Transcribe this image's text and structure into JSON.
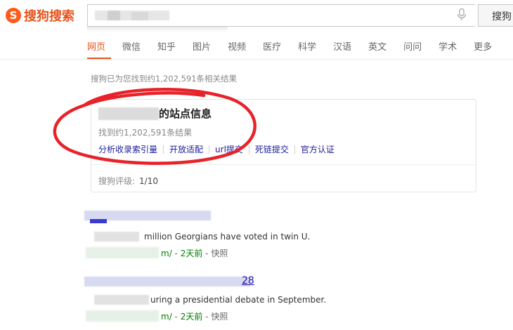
{
  "header": {
    "logo_text": "搜狗搜索",
    "logo_mark": "S",
    "search_button": "搜狗",
    "search_value": "",
    "mic_icon": "microphone-icon"
  },
  "tabs": [
    "网页",
    "微信",
    "知乎",
    "图片",
    "视频",
    "医疗",
    "科学",
    "汉语",
    "英文",
    "问问",
    "学术",
    "更多"
  ],
  "active_tab": "网页",
  "result_count_text": "搜狗已为您找到约1,202,591条相关结果",
  "site_card": {
    "title_suffix": "的站点信息",
    "count_text": "找到约1,202,591条结果",
    "links": [
      "分析收录索引量",
      "开放适配",
      "url提交",
      "死链提交",
      "官方认证"
    ],
    "rating_label": "搜狗评级:",
    "rating_value": "1/10"
  },
  "results": [
    {
      "title_tail": "",
      "snippet": "million Georgians have voted in twin U.",
      "url_tail": "m/",
      "time": "2天前",
      "snapshot": "快照"
    },
    {
      "title_tail": "28",
      "snippet": "uring a presidential debate in September.",
      "url_tail": "m/",
      "time": "2天前",
      "snapshot": "快照"
    }
  ],
  "colors": {
    "brand": "#e5531a",
    "link": "#1a1a9c",
    "annotation": "#e8222a"
  }
}
